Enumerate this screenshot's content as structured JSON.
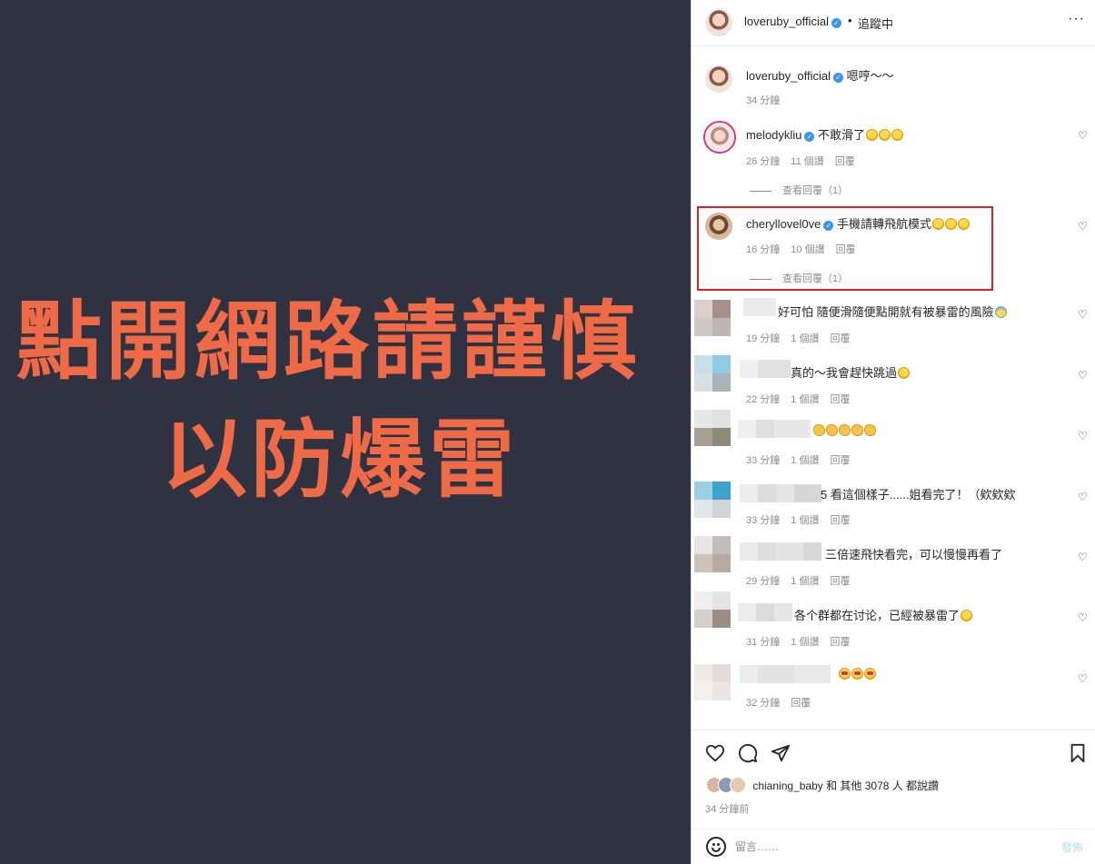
{
  "media": {
    "line1": "點開網路請謹慎",
    "line2": "以防爆雷"
  },
  "header": {
    "username": "loveruby_official",
    "dot": "•",
    "follow_status": "追蹤中",
    "more": "···"
  },
  "caption": {
    "username": "loveruby_official",
    "text": "嗯哼～～",
    "time": "34 分鐘"
  },
  "comments": [
    {
      "username": "melodykliu",
      "text": "不敢滑了",
      "emoji_count": 3,
      "time": "26 分鐘",
      "likes": "11 個讚",
      "reply": "回覆",
      "view_replies": "查看回覆（1）"
    },
    {
      "username": "cheryllovel0ve",
      "text": "手機請轉飛航模式",
      "emoji_count": 3,
      "time": "16 分鐘",
      "likes": "10 個讚",
      "reply": "回覆",
      "view_replies": "查看回覆（1）"
    },
    {
      "text": "好可怕 隨便滑隨便點開就有被暴雷的風險",
      "time": "19 分鐘",
      "likes": "1 個讚",
      "reply": "回覆"
    },
    {
      "text": "真的～我會趕快跳過",
      "time": "22 分鐘",
      "likes": "1 個讚",
      "reply": "回覆"
    },
    {
      "text": "",
      "time": "33 分鐘",
      "likes": "1 個讚",
      "reply": "回覆"
    },
    {
      "text": "5 看這個樣子......姐看完了！（欸欸欸",
      "time": "33 分鐘",
      "likes": "1 個讚",
      "reply": "回覆"
    },
    {
      "text": "三倍速飛快看完，可以慢慢再看了",
      "time": "29 分鐘",
      "likes": "1 個讚",
      "reply": "回覆"
    },
    {
      "text": "各个群都在讨论，已經被暴雷了",
      "time": "31 分鐘",
      "likes": "1 個讚",
      "reply": "回覆"
    },
    {
      "text": "",
      "time": "32 分鐘",
      "reply": "回覆"
    }
  ],
  "likes_line": {
    "username": "chianing_baby",
    "rest": "和 其他 3078 人 都說讚"
  },
  "time_ago": "34 分鐘前",
  "composer": {
    "placeholder": "留言……",
    "post_label": "發佈"
  },
  "icons": {
    "like": "heart-icon",
    "comment": "comment-icon",
    "share": "share-icon",
    "save": "bookmark-icon",
    "emoji": "emoji-icon",
    "verified": "verified-badge-icon"
  },
  "colors": {
    "headline": "#ef6a46",
    "media_bg": "#2f3240",
    "highlight_box": "#e02020",
    "verified": "#3897f0"
  }
}
